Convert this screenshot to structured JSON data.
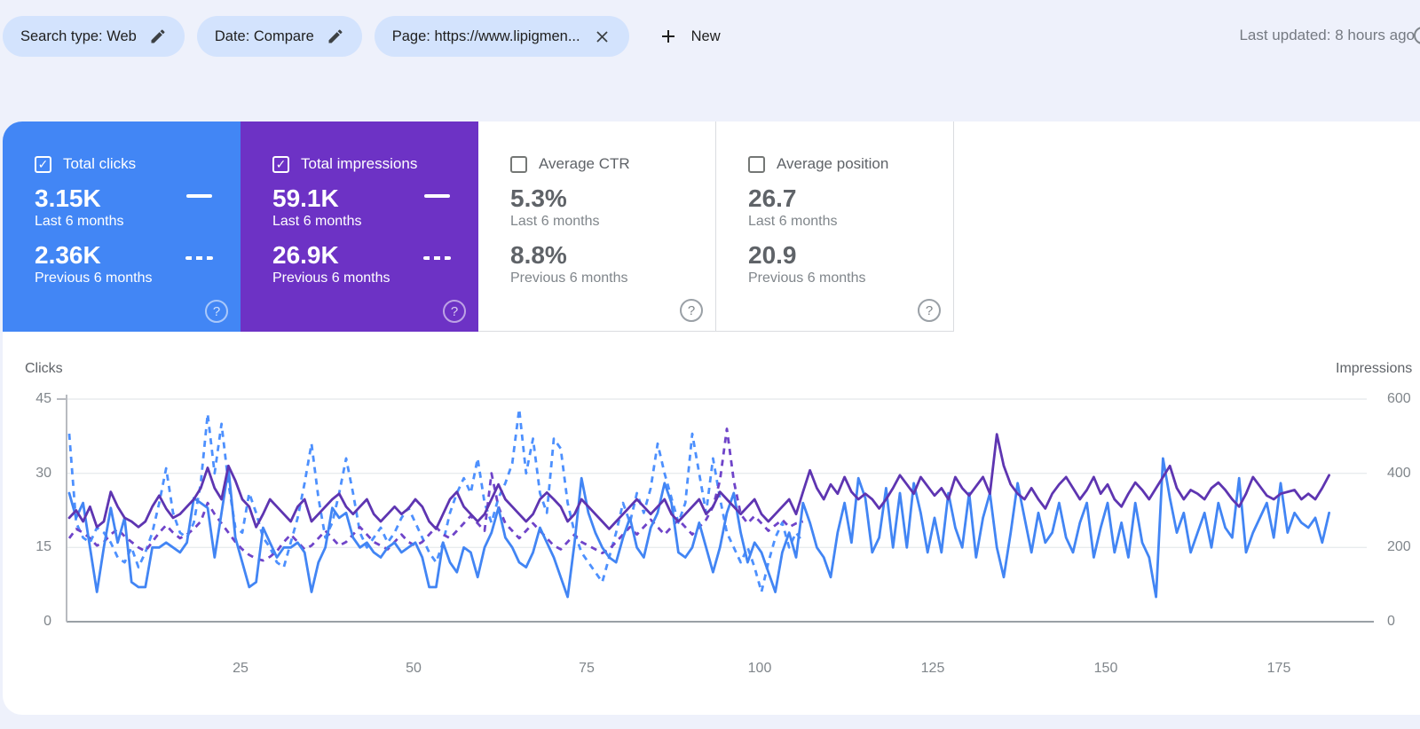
{
  "topbar": {
    "chips": [
      {
        "label": "Search type: Web",
        "icon": "pencil"
      },
      {
        "label": "Date: Compare",
        "icon": "pencil"
      },
      {
        "label": "Page: https://www.lipigmen...",
        "icon": "close"
      }
    ],
    "new_button_label": "New",
    "last_updated": "Last updated: 8 hours ago"
  },
  "colors": {
    "clicks_blue": "#4285f4",
    "clicks_blue_prev": "#4d90fe",
    "impressions_purple": "#5e35b1",
    "impressions_purple_prev": "#6f44c9",
    "card_blue": "#4286f5",
    "card_purple": "#6d32c5",
    "chip_bg": "#d3e3fd"
  },
  "cards": [
    {
      "title": "Total clicks",
      "checked": true,
      "bg": "#4286f5",
      "value_current": "3.15K",
      "label_current": "Last 6 months",
      "value_previous": "2.36K",
      "label_previous": "Previous 6 months"
    },
    {
      "title": "Total impressions",
      "checked": true,
      "bg": "#6d32c5",
      "value_current": "59.1K",
      "label_current": "Last 6 months",
      "value_previous": "26.9K",
      "label_previous": "Previous 6 months"
    },
    {
      "title": "Average CTR",
      "checked": false,
      "value_current": "5.3%",
      "label_current": "Last 6 months",
      "value_previous": "8.8%",
      "label_previous": "Previous 6 months"
    },
    {
      "title": "Average position",
      "checked": false,
      "value_current": "26.7",
      "label_current": "Last 6 months",
      "value_previous": "20.9",
      "label_previous": "Previous 6 months"
    }
  ],
  "chart_data": {
    "type": "line",
    "x": {
      "ticks": [
        25,
        50,
        75,
        100,
        125,
        150,
        175
      ],
      "max": 183
    },
    "y_left": {
      "label": "Clicks",
      "ticks": [
        45,
        30,
        15,
        0
      ],
      "max": 45
    },
    "y_right": {
      "label": "Impressions",
      "ticks": [
        600,
        400,
        200,
        0
      ],
      "max": 600
    },
    "grid": true,
    "legend": "none",
    "series": [
      {
        "name": "Clicks - Last 6 months",
        "axis": "left",
        "style": "solid",
        "color": "#4285f4",
        "values": [
          26,
          21,
          24,
          15,
          6,
          15,
          23,
          16,
          21,
          8,
          7,
          7,
          15,
          15,
          16,
          15,
          14,
          16,
          25,
          24,
          23,
          13,
          22,
          31,
          17,
          12,
          7,
          8,
          19,
          16,
          13,
          15,
          15,
          16,
          14,
          6,
          12,
          15,
          23,
          21,
          22,
          17,
          15,
          16,
          14,
          13,
          15,
          16,
          14,
          15,
          16,
          13,
          7,
          7,
          16,
          12,
          10,
          15,
          14,
          9,
          15,
          18,
          23,
          17,
          15,
          12,
          11,
          14,
          19,
          16,
          13,
          9,
          5,
          16,
          29,
          22,
          18,
          15,
          13,
          12,
          17,
          21,
          15,
          13,
          19,
          22,
          28,
          24,
          14,
          13,
          15,
          20,
          15,
          10,
          15,
          22,
          26,
          18,
          12,
          16,
          14,
          10,
          6,
          14,
          18,
          13,
          24,
          20,
          15,
          13,
          9,
          18,
          24,
          16,
          29,
          25,
          14,
          17,
          27,
          15,
          26,
          15,
          28,
          22,
          14,
          21,
          14,
          26,
          19,
          15,
          26,
          13,
          21,
          26,
          15,
          9,
          18,
          28,
          21,
          14,
          22,
          16,
          18,
          24,
          17,
          14,
          20,
          24,
          13,
          19,
          24,
          14,
          20,
          13,
          24,
          16,
          13,
          5,
          33,
          25,
          18,
          22,
          14,
          18,
          22,
          15,
          24,
          19,
          17,
          29,
          14,
          18,
          21,
          24,
          17,
          28,
          18,
          22,
          20,
          19,
          21,
          16,
          22
        ]
      },
      {
        "name": "Clicks - Previous 6 months",
        "axis": "left",
        "style": "dashed",
        "color": "#4d90fe",
        "values": [
          38,
          20,
          17,
          16,
          19,
          18,
          16,
          13,
          12,
          15,
          11,
          14,
          18,
          24,
          31,
          22,
          18,
          17,
          20,
          28,
          42,
          30,
          40,
          28,
          19,
          18,
          26,
          22,
          17,
          15,
          12,
          11,
          16,
          21,
          28,
          36,
          25,
          17,
          20,
          26,
          33,
          26,
          18,
          15,
          17,
          19,
          16,
          18,
          21,
          23,
          20,
          17,
          14,
          12,
          16,
          22,
          26,
          29,
          26,
          33,
          24,
          20,
          25,
          28,
          32,
          43,
          30,
          37,
          26,
          22,
          37,
          35,
          24,
          18,
          14,
          12,
          10,
          8,
          13,
          18,
          24,
          20,
          26,
          22,
          27,
          36,
          30,
          25,
          20,
          24,
          38,
          30,
          22,
          33,
          25,
          18,
          15,
          12,
          15,
          11,
          6,
          12,
          17,
          20,
          15,
          18,
          16
        ]
      },
      {
        "name": "Impressions - Last 6 months",
        "axis": "right",
        "style": "solid",
        "color": "#5e35b1",
        "values": [
          280,
          300,
          270,
          310,
          255,
          270,
          350,
          310,
          280,
          270,
          255,
          270,
          310,
          340,
          305,
          280,
          290,
          310,
          330,
          360,
          415,
          360,
          330,
          420,
          380,
          330,
          310,
          255,
          290,
          330,
          310,
          290,
          270,
          310,
          330,
          270,
          290,
          310,
          330,
          345,
          310,
          290,
          310,
          330,
          290,
          270,
          290,
          310,
          290,
          305,
          330,
          310,
          270,
          250,
          290,
          330,
          350,
          310,
          290,
          270,
          290,
          330,
          370,
          330,
          310,
          290,
          270,
          290,
          330,
          348,
          330,
          310,
          270,
          290,
          330,
          310,
          290,
          270,
          250,
          270,
          290,
          310,
          330,
          310,
          290,
          310,
          330,
          290,
          270,
          290,
          310,
          330,
          290,
          310,
          350,
          330,
          310,
          290,
          310,
          330,
          290,
          270,
          290,
          310,
          330,
          290,
          350,
          408,
          360,
          330,
          370,
          345,
          390,
          350,
          330,
          345,
          330,
          305,
          330,
          360,
          395,
          370,
          345,
          390,
          365,
          340,
          360,
          330,
          390,
          360,
          340,
          365,
          390,
          345,
          505,
          420,
          370,
          345,
          330,
          360,
          330,
          305,
          345,
          370,
          390,
          360,
          330,
          355,
          390,
          345,
          370,
          330,
          310,
          345,
          375,
          355,
          330,
          360,
          390,
          420,
          360,
          330,
          355,
          345,
          330,
          360,
          375,
          355,
          330,
          310,
          345,
          390,
          365,
          340,
          330,
          345,
          350,
          355,
          330,
          345,
          330,
          360,
          395
        ]
      },
      {
        "name": "Impressions - Previous 6 months",
        "axis": "right",
        "style": "dashed",
        "color": "#6f44c9",
        "values": [
          225,
          250,
          240,
          225,
          205,
          215,
          235,
          250,
          230,
          215,
          200,
          190,
          215,
          240,
          260,
          240,
          225,
          235,
          250,
          270,
          320,
          290,
          265,
          240,
          215,
          195,
          180,
          170,
          165,
          175,
          190,
          215,
          235,
          215,
          195,
          205,
          225,
          245,
          225,
          205,
          215,
          235,
          255,
          235,
          215,
          205,
          195,
          215,
          235,
          215,
          205,
          215,
          235,
          255,
          235,
          225,
          245,
          265,
          285,
          265,
          245,
          400,
          310,
          265,
          245,
          225,
          245,
          265,
          245,
          225,
          205,
          195,
          215,
          235,
          215,
          205,
          195,
          185,
          195,
          215,
          235,
          255,
          235,
          255,
          275,
          255,
          235,
          255,
          275,
          255,
          235,
          255,
          275,
          310,
          380,
          520,
          380,
          290,
          265,
          285,
          265,
          245,
          260,
          275,
          255,
          265,
          270
        ]
      }
    ]
  }
}
